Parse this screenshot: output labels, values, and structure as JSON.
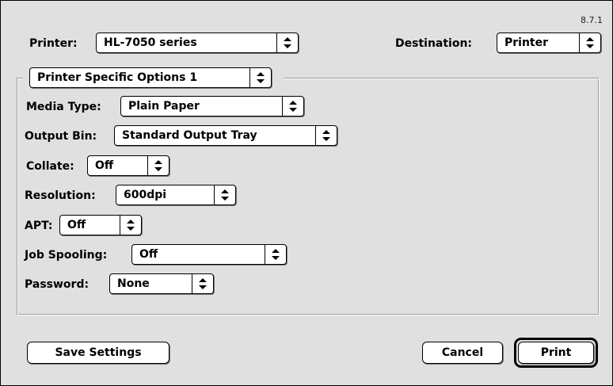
{
  "version": "8.7.1",
  "printer": {
    "label": "Printer:",
    "value": "HL-7050 series"
  },
  "destination": {
    "label": "Destination:",
    "value": "Printer"
  },
  "options_panel": {
    "value": "Printer Specific Options 1"
  },
  "fields": {
    "media_type": {
      "label": "Media Type:",
      "value": "Plain Paper"
    },
    "output_bin": {
      "label": "Output Bin:",
      "value": "Standard Output Tray"
    },
    "collate": {
      "label": "Collate:",
      "value": "Off"
    },
    "resolution": {
      "label": "Resolution:",
      "value": "600dpi"
    },
    "apt": {
      "label": "APT:",
      "value": "Off"
    },
    "job_spooling": {
      "label": "Job Spooling:",
      "value": "Off"
    },
    "password": {
      "label": "Password:",
      "value": "None"
    }
  },
  "buttons": {
    "save_settings": "Save Settings",
    "cancel": "Cancel",
    "print": "Print"
  },
  "icons": {
    "popup_arrows": "up-down-arrows-icon"
  }
}
